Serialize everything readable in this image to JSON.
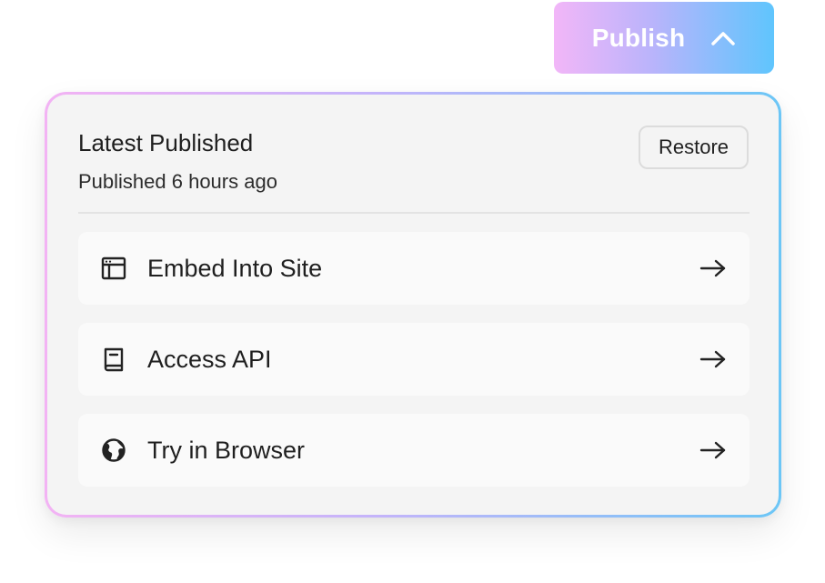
{
  "publish_button": {
    "label": "Publish",
    "icon": "chevron-up-icon",
    "gradient": [
      "#f2b6f8",
      "#b9b4fb",
      "#5fc5fd"
    ]
  },
  "panel": {
    "title": "Latest Published",
    "subtitle": "Published 6 hours ago",
    "restore_label": "Restore",
    "options": [
      {
        "label": "Embed Into Site",
        "icon": "browser-window-icon"
      },
      {
        "label": "Access API",
        "icon": "book-icon"
      },
      {
        "label": "Try in Browser",
        "icon": "globe-icon"
      }
    ]
  }
}
